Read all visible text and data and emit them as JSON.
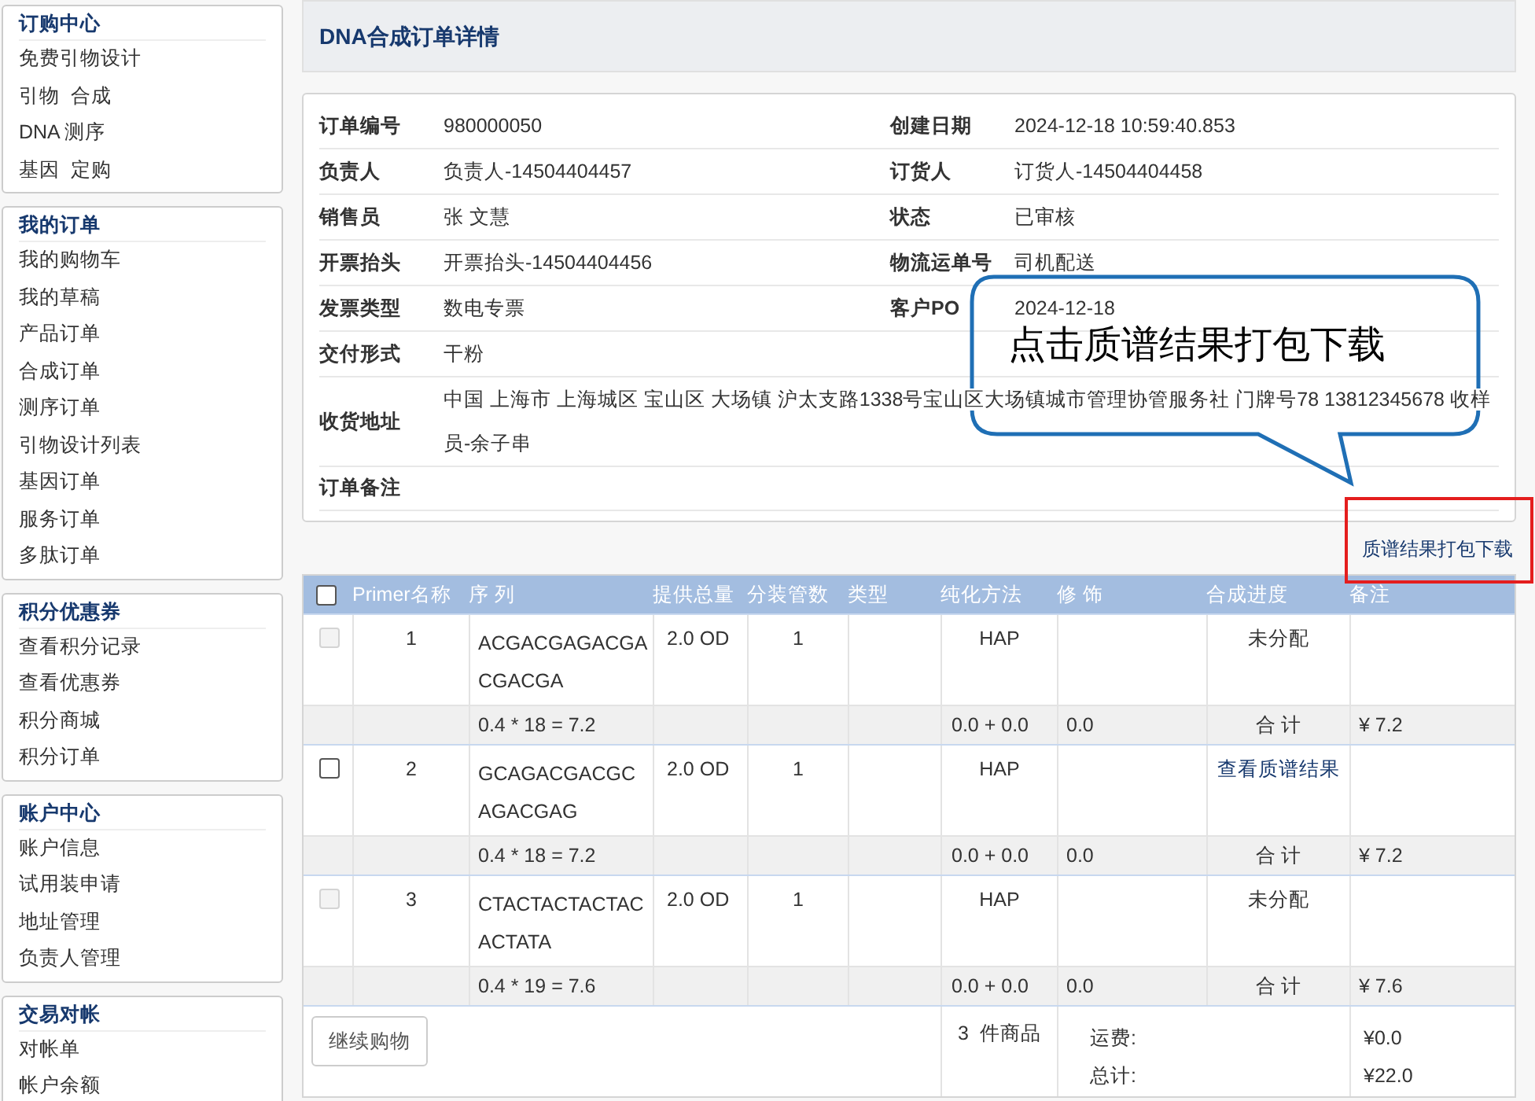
{
  "sidebar": [
    {
      "title": "订购中心",
      "items": [
        "免费引物设计",
        "引物  合成",
        "DNA 测序",
        "基因  定购"
      ]
    },
    {
      "title": "我的订单",
      "items": [
        "我的购物车",
        "我的草稿",
        "产品订单",
        "合成订单",
        "测序订单",
        "引物设计列表",
        "基因订单",
        "服务订单",
        "多肽订单"
      ]
    },
    {
      "title": "积分优惠券",
      "items": [
        "查看积分记录",
        "查看优惠券",
        "积分商城",
        "积分订单"
      ]
    },
    {
      "title": "账户中心",
      "items": [
        "账户信息",
        "试用装申请",
        "地址管理",
        "负责人管理"
      ]
    },
    {
      "title": "交易对帐",
      "items": [
        "对帐单",
        "帐户余额"
      ]
    }
  ],
  "page_title": "DNA合成订单详情",
  "order_info": [
    {
      "cells": [
        {
          "label": "订单编号",
          "value": "980000050"
        },
        {
          "label": "创建日期",
          "value": "2024-12-18 10:59:40.853"
        }
      ]
    },
    {
      "cells": [
        {
          "label": "负责人",
          "value": "负责人-14504404457"
        },
        {
          "label": "订货人",
          "value": "订货人-14504404458"
        }
      ]
    },
    {
      "cells": [
        {
          "label": "销售员",
          "value": "张 文慧"
        },
        {
          "label": "状态",
          "value": "已审核"
        }
      ]
    },
    {
      "cells": [
        {
          "label": "开票抬头",
          "value": "开票抬头-14504404456"
        },
        {
          "label": "物流运单号",
          "value": "司机配送"
        }
      ]
    },
    {
      "cells": [
        {
          "label": "发票类型",
          "value": "数电专票"
        },
        {
          "label": "客户PO",
          "value": "2024-12-18"
        }
      ]
    },
    {
      "cells": [
        {
          "label": "交付形式",
          "value": "干粉"
        }
      ]
    },
    {
      "cells": [
        {
          "label": "收货地址",
          "value": "中国 上海市 上海城区 宝山区 大场镇 沪太支路1338号宝山区大场镇城市管理协管服务社 门牌号78 13812345678 收样员-余子串"
        }
      ]
    },
    {
      "cells": [
        {
          "label": "订单备注"
        }
      ]
    }
  ],
  "download_link": "质谱结果打包下载",
  "table": {
    "select_all": {
      "checked": false
    },
    "columns": [
      "Primer名称",
      "序 列",
      "提供总量",
      "分装管数",
      "类型",
      "纯化方法",
      "修 饰",
      "合成进度",
      "备注"
    ],
    "rows": [
      {
        "checked": false,
        "disabled": true,
        "name": "1",
        "sequence": "ACGACGAGACGACGACGA",
        "amount": "2.0 OD",
        "tubes": "1",
        "purification": "HAP",
        "progress": {
          "kind": "text",
          "text": "未分配"
        },
        "formula": "0.4 * 18 = 7.2",
        "purification_cost": "0.0 + 0.0",
        "modification_cost": "0.0",
        "subtotal_label": "合 计",
        "subtotal": "¥ 7.2"
      },
      {
        "checked": false,
        "disabled": false,
        "name": "2",
        "sequence": "GCAGACGACGCAGACGAG",
        "amount": "2.0 OD",
        "tubes": "1",
        "purification": "HAP",
        "progress": {
          "kind": "link",
          "text": "查看质谱结果"
        },
        "formula": "0.4 * 18 = 7.2",
        "purification_cost": "0.0 + 0.0",
        "modification_cost": "0.0",
        "subtotal_label": "合 计",
        "subtotal": "¥ 7.2"
      },
      {
        "checked": false,
        "disabled": true,
        "name": "3",
        "sequence": "CTACTACTACTACACTATA",
        "amount": "2.0 OD",
        "tubes": "1",
        "purification": "HAP",
        "progress": {
          "kind": "text",
          "text": "未分配"
        },
        "formula": "0.4 * 19 = 7.6",
        "purification_cost": "0.0 + 0.0",
        "modification_cost": "0.0",
        "subtotal_label": "合 计",
        "subtotal": "¥ 7.6"
      }
    ],
    "footer": {
      "button": "继续购物",
      "count": "3  件商品",
      "shipping_label": "运费:",
      "shipping": "¥0.0",
      "total_label": "总计:",
      "total": "¥22.0"
    }
  },
  "callout": {
    "text": "点击质谱结果打包下载"
  }
}
